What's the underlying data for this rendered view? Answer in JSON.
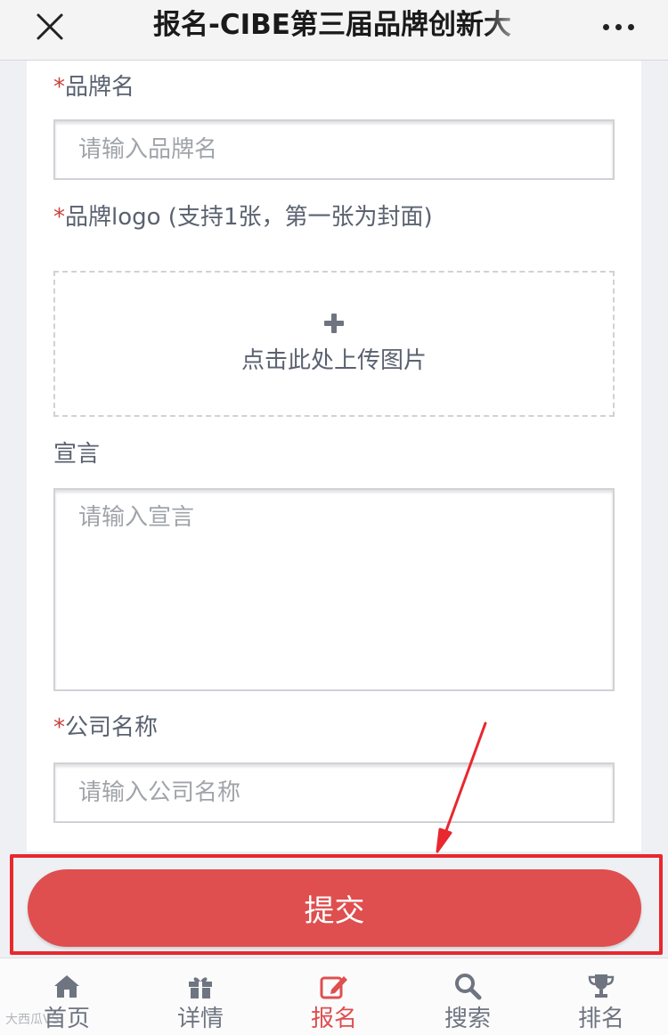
{
  "topbar": {
    "title": "报名-CIBE第三届品牌创新大",
    "close_icon": "close-icon",
    "more_icon": "more-icon"
  },
  "form": {
    "required_mark": "*",
    "brand_name": {
      "label": "品牌名",
      "placeholder": "请输入品牌名"
    },
    "brand_logo": {
      "label": "品牌logo (支持1张，第一张为封面)",
      "upload_text": "点击此处上传图片",
      "icon": "plus-icon"
    },
    "manifesto": {
      "label": "宣言",
      "placeholder": "请输入宣言"
    },
    "company_name": {
      "label": "公司名称",
      "placeholder": "请输入公司名称"
    },
    "submit_label": "提交"
  },
  "tabbar": {
    "items": [
      {
        "label": "首页",
        "icon": "home-icon",
        "active": false
      },
      {
        "label": "详情",
        "icon": "gift-icon",
        "active": false
      },
      {
        "label": "报名",
        "icon": "edit-icon",
        "active": true
      },
      {
        "label": "搜索",
        "icon": "search-icon",
        "active": false
      },
      {
        "label": "排名",
        "icon": "trophy-icon",
        "active": false
      }
    ]
  },
  "watermark": "大西瓜VS",
  "colors": {
    "accent": "#df4f4f",
    "highlight": "#e8282e",
    "label": "#5a6270"
  }
}
